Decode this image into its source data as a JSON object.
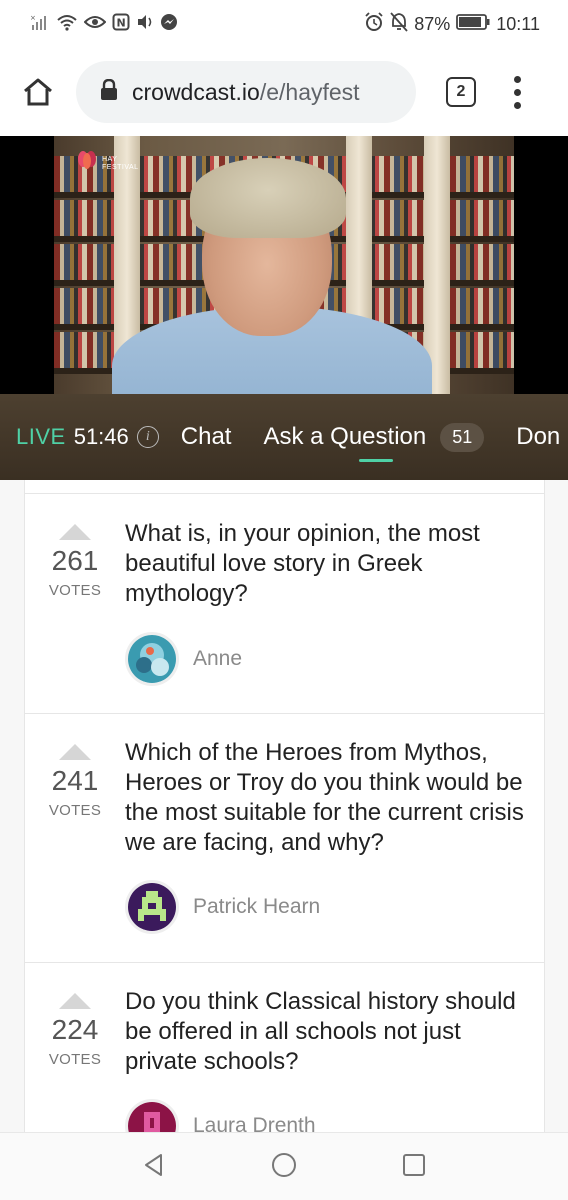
{
  "status_bar": {
    "battery": "87%",
    "time": "10:11"
  },
  "browser": {
    "url_host": "crowdcast.io",
    "url_path": "/e/hayfest",
    "tab_count": "2"
  },
  "video": {
    "logo_text_line1": "HAY",
    "logo_text_line2": "FESTIVAL"
  },
  "live_bar": {
    "live_label": "LIVE",
    "elapsed": "51:46",
    "tabs": [
      {
        "label": "Chat"
      },
      {
        "label": "Ask a Question",
        "badge": "51"
      },
      {
        "label": "Don"
      }
    ]
  },
  "questions": [
    {
      "votes": "261",
      "votes_label": "VOTES",
      "text": "What is, in your opinion, the most beautiful love story in Greek mythology?",
      "author": "Anne"
    },
    {
      "votes": "241",
      "votes_label": "VOTES",
      "text": "Which of the Heroes from Mythos, Heroes or Troy do you think would be the most suitable for the current crisis we are facing, and why?",
      "author": "Patrick Hearn"
    },
    {
      "votes": "224",
      "votes_label": "VOTES",
      "text": "Do you think Classical history should be offered in all schools not just private schools?",
      "author": "Laura Drenth"
    }
  ],
  "colors": {
    "live_green": "#4fd1a6",
    "live_bar_bg": "#3f3326"
  }
}
